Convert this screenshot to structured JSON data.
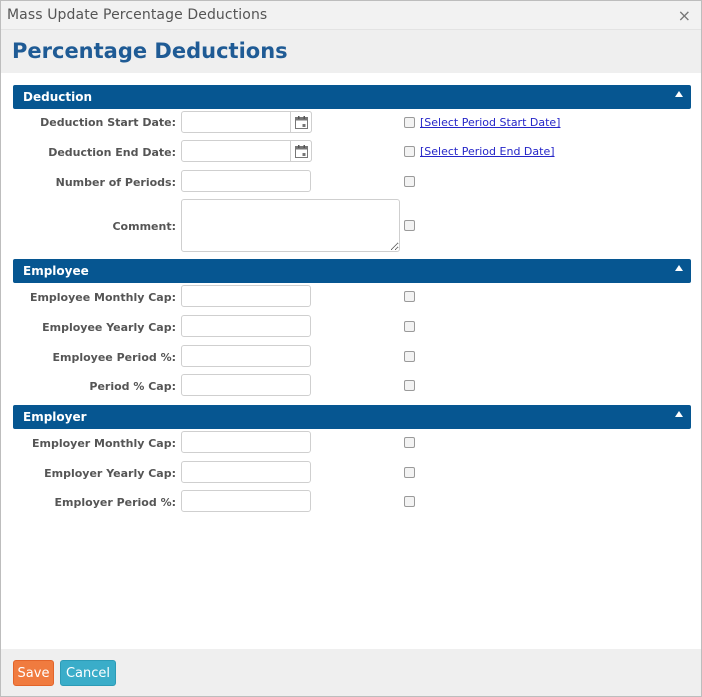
{
  "window": {
    "title": "Mass Update Percentage Deductions",
    "close_glyph": "×"
  },
  "page": {
    "title": "Percentage Deductions"
  },
  "sections": {
    "deduction": {
      "title": "Deduction",
      "start_date_label": "Deduction Start Date:",
      "end_date_label": "Deduction End Date:",
      "periods_label": "Number of Periods:",
      "comment_label": "Comment:",
      "select_start_link": "[Select Period Start Date]",
      "select_end_link": "[Select Period End Date]"
    },
    "employee": {
      "title": "Employee",
      "monthly_cap_label": "Employee Monthly Cap:",
      "yearly_cap_label": "Employee Yearly Cap:",
      "period_pct_label": "Employee Period %:",
      "period_pct_cap_label": "Period % Cap:"
    },
    "employer": {
      "title": "Employer",
      "monthly_cap_label": "Employer Monthly Cap:",
      "yearly_cap_label": "Employer Yearly Cap:",
      "period_pct_label": "Employer Period %:"
    }
  },
  "footer": {
    "save_label": "Save",
    "cancel_label": "Cancel"
  },
  "icons": {
    "calendar": "calendar-icon",
    "collapse": "collapse-arrow-icon",
    "close": "close-icon"
  },
  "colors": {
    "section_bar": "#065691",
    "title": "#1f5b95",
    "save": "#f07b3f",
    "cancel": "#3aadc9",
    "link": "#2525c8"
  }
}
